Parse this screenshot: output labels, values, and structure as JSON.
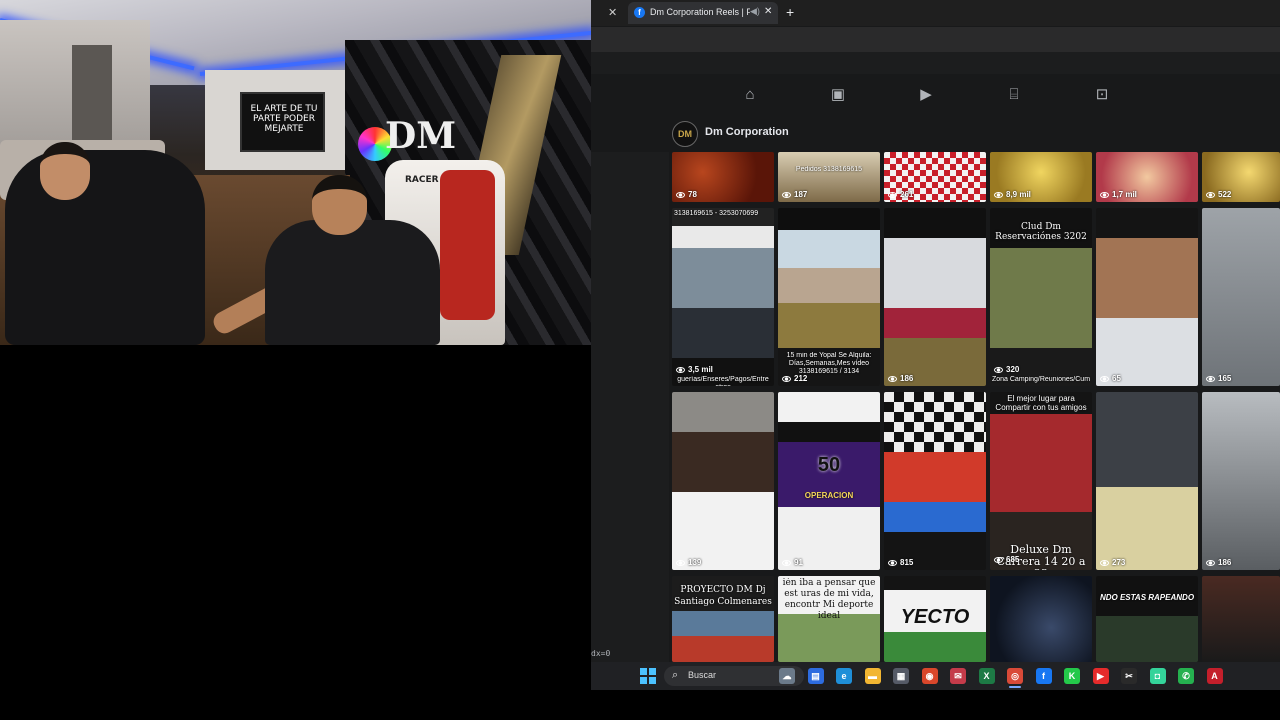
{
  "webcam": {
    "tv_text": "EL ARTE DE TU PARTE PODER MEJARTE",
    "chair_brand": "RACER",
    "wall_logo": "DM"
  },
  "browser": {
    "tab": {
      "close_left": "✕",
      "favicon": "f",
      "title": "Dm Corporation Reels | Fac",
      "audio_icon": "◀)",
      "close": "✕",
      "new_tab": "+"
    },
    "nav_icons": [
      {
        "name": "home-icon",
        "glyph": "⌂"
      },
      {
        "name": "video-icon",
        "glyph": "▣"
      },
      {
        "name": "reels-icon",
        "glyph": "▶"
      },
      {
        "name": "marketplace-icon",
        "glyph": "⌸"
      },
      {
        "name": "gaming-icon",
        "glyph": "⊡"
      }
    ],
    "page": {
      "avatar_text": "DM",
      "name": "Dm Corporation"
    },
    "debug_text": "dx=0"
  },
  "reels": {
    "row1": [
      {
        "views": "78",
        "caption": ""
      },
      {
        "views": "187",
        "caption": "Pedidos 3138169615"
      },
      {
        "views": "261",
        "caption": ""
      },
      {
        "views": "8,9 mil",
        "caption": ""
      },
      {
        "views": "1,7 mil",
        "caption": ""
      },
      {
        "views": "522",
        "caption": ""
      }
    ],
    "row2": [
      {
        "views": "3,5 mil",
        "caption_top": "3138169615 - 3253070699",
        "caption": "guerías/Enseres/Pagos/Entre otros"
      },
      {
        "views": "212",
        "caption_top": "",
        "caption": "15 min de Yopal Se Alquila: Días,Semanas,Mes vídeo 3138169615 / 3134"
      },
      {
        "views": "186",
        "caption_top": "",
        "caption": ""
      },
      {
        "views": "320",
        "caption_top": "Clud Dm Reservaciónes 3202",
        "caption": "Zona Camping/Reuniones/Cum"
      },
      {
        "views": "65",
        "caption_top": "",
        "caption": ""
      },
      {
        "views": "165",
        "caption_top": "",
        "caption": ""
      }
    ],
    "row3": [
      {
        "views": "139",
        "caption_top": "",
        "caption": ""
      },
      {
        "views": "91",
        "caption_top": "50",
        "caption": "OPERACIÓN"
      },
      {
        "views": "815",
        "caption_top": "",
        "caption": ""
      },
      {
        "views": "685",
        "caption_top": "El mejor lugar para Compartir con tus amigos",
        "caption": "Deluxe Dm Carrera 14 20 a 23"
      },
      {
        "views": "273",
        "caption_top": "",
        "caption": ""
      },
      {
        "views": "186",
        "caption_top": "",
        "caption": ""
      }
    ],
    "row4": [
      {
        "caption": "PROYECTO DM Dj Santiago Colmenares"
      },
      {
        "caption": "ién iba a pensar que est uras de mi vida, encontr Mi deporte ideal"
      },
      {
        "caption": "YECTO"
      },
      {
        "caption": ""
      },
      {
        "caption": "NDO ESTAS RAPEANDO"
      },
      {
        "caption": ""
      }
    ]
  },
  "taskbar": {
    "search_placeholder": "Buscar",
    "search_glyph": "⌕",
    "apps": [
      {
        "name": "weather-icon",
        "glyph": "☁",
        "color": "#6b7a8a"
      },
      {
        "name": "taskview-icon",
        "glyph": "▤",
        "color": "#2d6cdf"
      },
      {
        "name": "edge-icon",
        "glyph": "e",
        "color": "#1f8fd8"
      },
      {
        "name": "file-explorer-icon",
        "glyph": "▬",
        "color": "#f2b632"
      },
      {
        "name": "store-icon",
        "glyph": "▦",
        "color": "#555a66"
      },
      {
        "name": "office-icon",
        "glyph": "◉",
        "color": "#d9472b"
      },
      {
        "name": "mail-icon",
        "glyph": "✉",
        "color": "#c43b4a"
      },
      {
        "name": "excel-icon",
        "glyph": "X",
        "color": "#1d7a45"
      },
      {
        "name": "chrome-icon",
        "glyph": "◎",
        "color": "#d94a38"
      },
      {
        "name": "facebook-icon",
        "glyph": "f",
        "color": "#1877f2"
      },
      {
        "name": "kick-icon",
        "glyph": "K",
        "color": "#24c94a"
      },
      {
        "name": "youtube-icon",
        "glyph": "▶",
        "color": "#e52b2b"
      },
      {
        "name": "capcut-icon",
        "glyph": "✂",
        "color": "#2a2a2a"
      },
      {
        "name": "streamlabs-icon",
        "glyph": "◘",
        "color": "#34d39a"
      },
      {
        "name": "whatsapp-icon",
        "glyph": "✆",
        "color": "#25b14f"
      },
      {
        "name": "acrobat-icon",
        "glyph": "A",
        "color": "#c41f2b"
      }
    ]
  },
  "colors": {
    "browser_bg": "#18191a",
    "text_primary": "#e4e6eb",
    "accent": "#1877f2",
    "led_blue": "#3d6bff"
  }
}
